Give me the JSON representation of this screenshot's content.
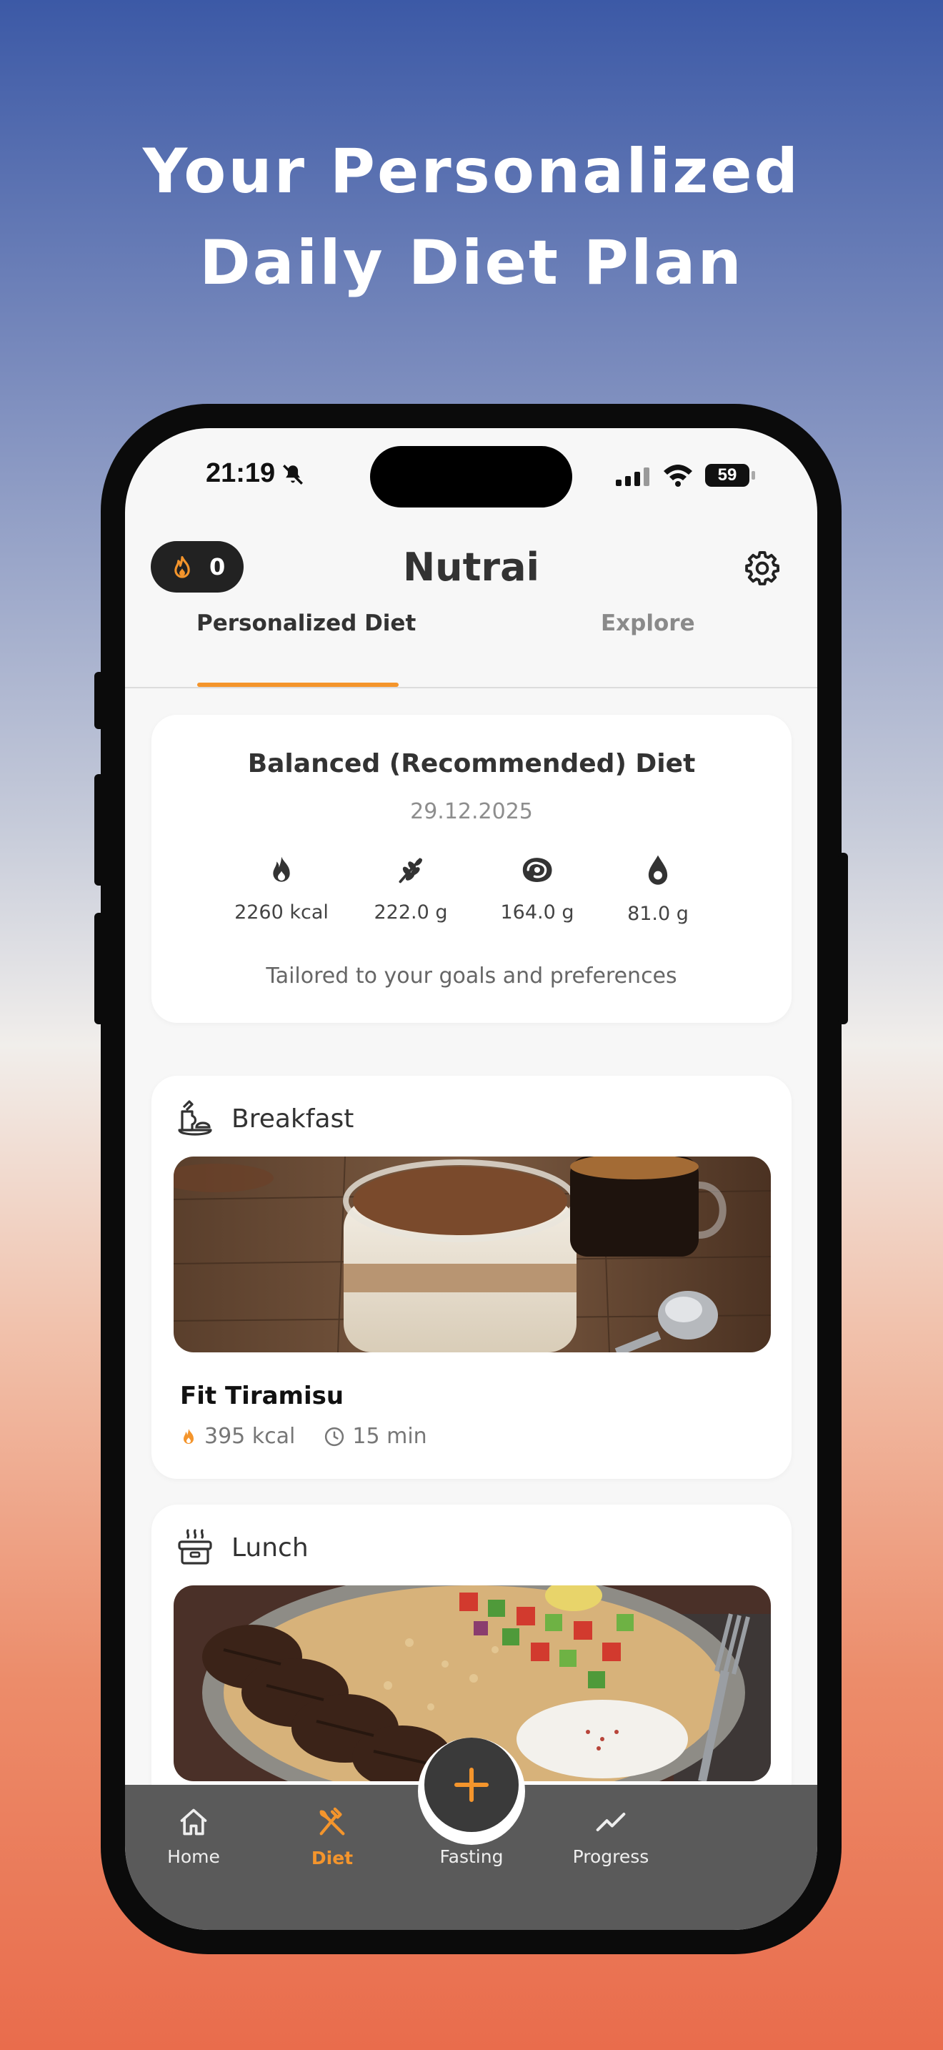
{
  "headline": {
    "line1": "Your Personalized",
    "line2": "Daily Diet Plan"
  },
  "status_bar": {
    "time": "21:19",
    "battery": "59"
  },
  "header": {
    "streak_count": "0",
    "app_title": "Nutrai"
  },
  "tabs": [
    {
      "label": "Personalized Diet",
      "active": true
    },
    {
      "label": "Explore",
      "active": false
    }
  ],
  "plan": {
    "title": "Balanced (Recommended) Diet",
    "date": "29.12.2025",
    "macros": [
      {
        "icon": "flame-icon",
        "value": "2260 kcal"
      },
      {
        "icon": "wheat-icon",
        "value": "222.0 g"
      },
      {
        "icon": "meat-icon",
        "value": "164.0 g"
      },
      {
        "icon": "drop-icon",
        "value": "81.0 g"
      }
    ],
    "tagline": "Tailored to your goals and preferences"
  },
  "meals": [
    {
      "section": "Breakfast",
      "name": "Fit Tiramisu",
      "kcal": "395 kcal",
      "time": "15 min"
    },
    {
      "section": "Lunch"
    }
  ],
  "nav": [
    {
      "label": "Home",
      "icon": "home-icon"
    },
    {
      "label": "Diet",
      "icon": "fork-knife-icon",
      "active": true
    },
    {
      "label": "Fasting",
      "icon": "stopwatch-icon"
    },
    {
      "label": "Progress",
      "icon": "trend-icon"
    }
  ],
  "colors": {
    "accent": "#f4952c",
    "navbar": "#5a5a5a",
    "dark": "#222222"
  }
}
